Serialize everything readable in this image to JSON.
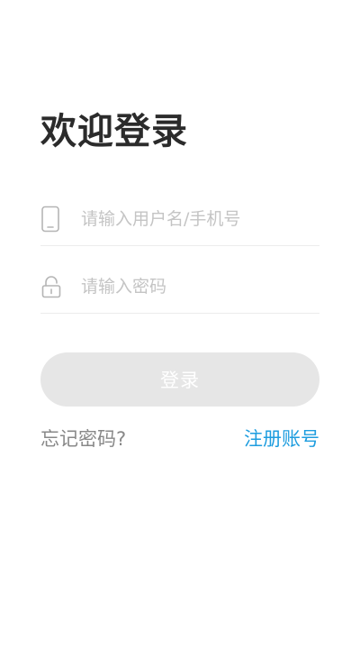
{
  "title": "欢迎登录",
  "username_field": {
    "placeholder": "请输入用户名/手机号",
    "value": "",
    "icon": "phone-icon"
  },
  "password_field": {
    "placeholder": "请输入密码",
    "value": "",
    "icon": "lock-icon"
  },
  "login_button": {
    "label": "登录"
  },
  "links": {
    "forgot_password": "忘记密码?",
    "register": "注册账号"
  },
  "colors": {
    "title": "#2b2b2b",
    "button_disabled_bg": "#e6e6e6",
    "link_accent": "#1e9ddf",
    "muted_text": "#888888",
    "placeholder": "#c4c4c4"
  }
}
